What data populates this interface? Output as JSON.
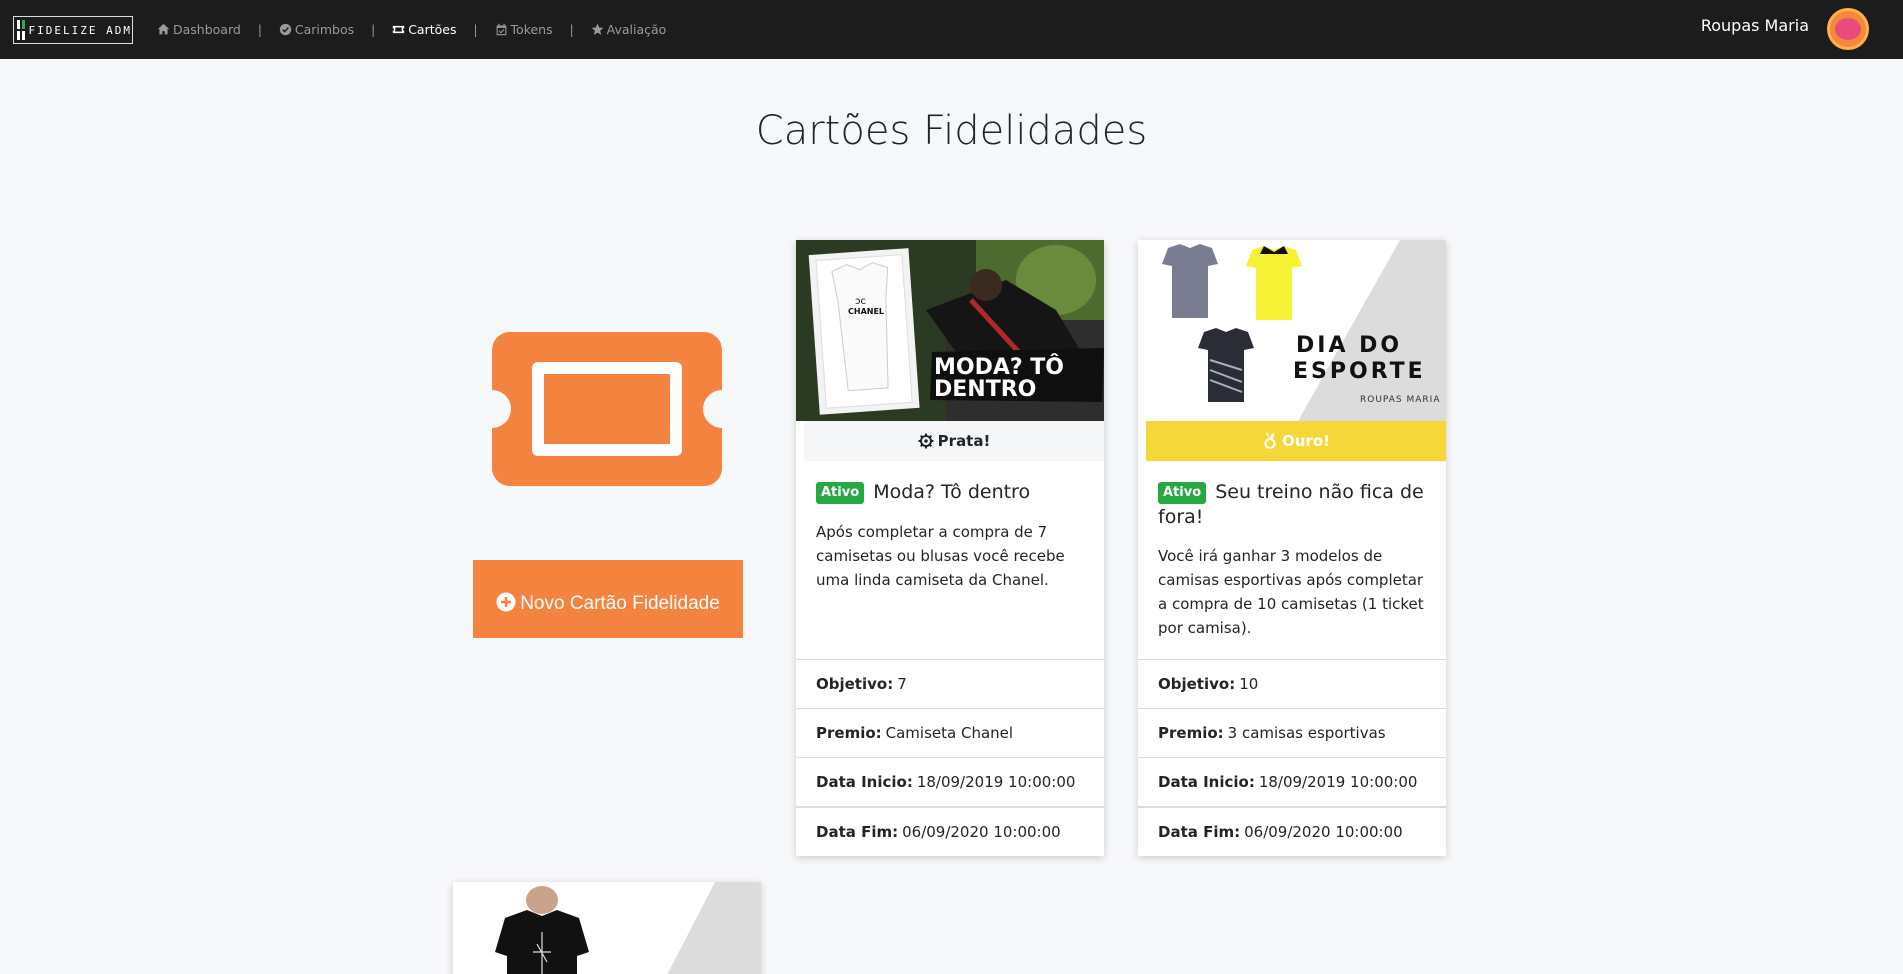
{
  "brand": {
    "logo_text": "FIDELIZE ADM"
  },
  "nav": [
    {
      "label": "Dashboard",
      "icon": "home-icon",
      "active": false
    },
    {
      "label": "Carimbos",
      "icon": "check-circle-icon",
      "active": false
    },
    {
      "label": "Cartões",
      "icon": "ticket-icon",
      "active": true
    },
    {
      "label": "Tokens",
      "icon": "calendar-check-icon",
      "active": false
    },
    {
      "label": "Avaliação",
      "icon": "star-icon",
      "active": false
    }
  ],
  "nav_separator": "|",
  "user": {
    "name": "Roupas Maria"
  },
  "page": {
    "title": "Cartões Fidelidades"
  },
  "new_card_button": {
    "label": "Novo Cartão Fidelidade",
    "icon": "plus-circle-icon"
  },
  "colors": {
    "accent": "#f3833f",
    "success": "#28a745",
    "gold": "#f5d73a",
    "silver_bg": "#f5f6f7",
    "navbar": "#1c1c1c"
  },
  "cards": [
    {
      "image_text": "MODA? TÔ DENTRO",
      "image_brand": "CHANEL",
      "level": "Prata!",
      "level_icon": "gear-icon",
      "status": "Ativo",
      "title": "Moda? Tô dentro",
      "description": "Após completar a compra de 7 camisetas ou blusas você recebe uma linda camiseta da Chanel.",
      "goal_label": "Objetivo:",
      "goal": "7",
      "prize_label": "Premio:",
      "prize": "Camiseta Chanel",
      "start_label": "Data Inicio:",
      "start": "18/09/2019 10:00:00",
      "end_label": "Data Fim:",
      "end": "06/09/2020 10:00:00"
    },
    {
      "image_text_line1": "DIA DO",
      "image_text_line2": "ESPORTE",
      "image_brand": "ROUPAS MARIA",
      "level": "Ouro!",
      "level_icon": "medal-icon",
      "status": "Ativo",
      "title": "Seu treino não fica de fora!",
      "description": "Você irá ganhar 3 modelos de camisas esportivas após completar a compra de 10 camisetas (1 ticket por camisa).",
      "goal_label": "Objetivo:",
      "goal": "10",
      "prize_label": "Premio:",
      "prize": "3 camisas esportivas",
      "start_label": "Data Inicio:",
      "start": "18/09/2019 10:00:00",
      "end_label": "Data Fim:",
      "end": "06/09/2020 10:00:00"
    }
  ]
}
